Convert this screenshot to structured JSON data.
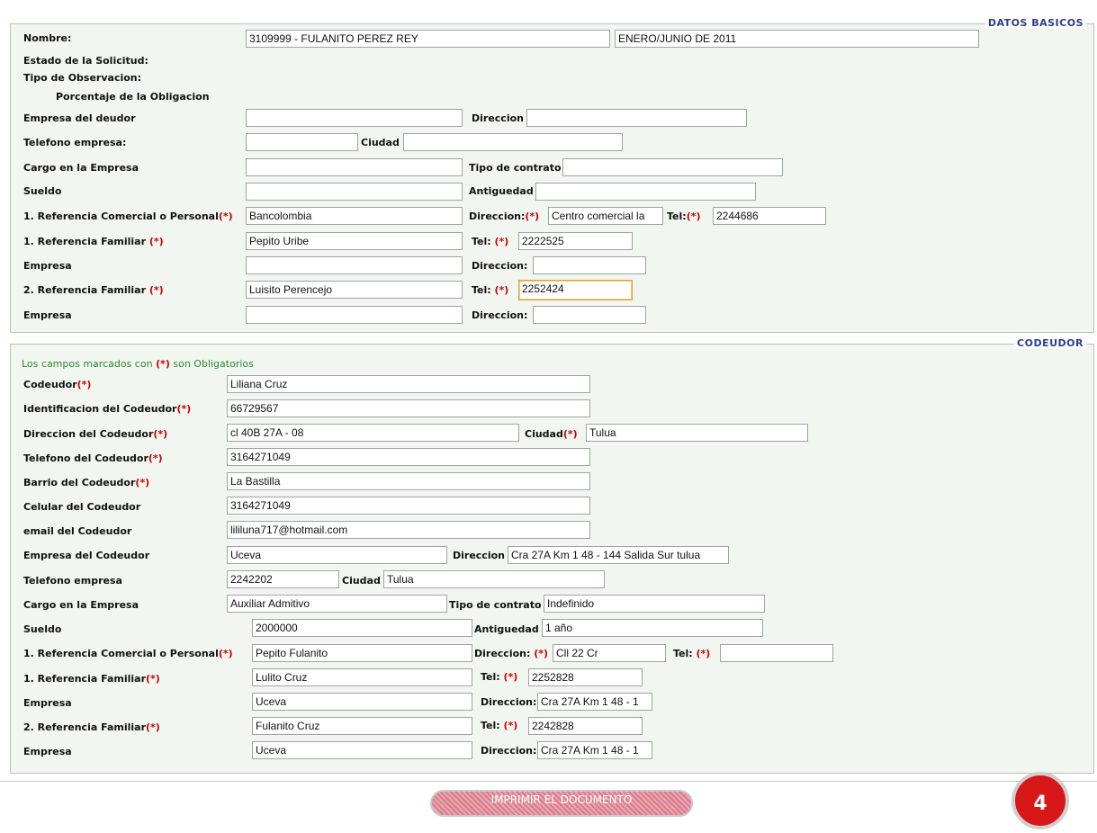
{
  "basic": {
    "legend": "DATOS BASICOS",
    "nombre_label": "Nombre:",
    "nombre_value": "3109999 - FULANITO PEREZ REY",
    "periodo_value": "ENERO/JUNIO DE 2011",
    "estado_label": "Estado de la Solicitud:",
    "tipo_obs_label": "Tipo de Observacion:",
    "porcentaje_label": "Porcentaje de la Obligacion",
    "empresa_deudor_label": "Empresa del deudor",
    "empresa_deudor_value": "",
    "direccion_label": "Direccion",
    "direccion_value": "",
    "telefono_empresa_label": "Telefono empresa:",
    "telefono_empresa_value": "",
    "ciudad_label": "Ciudad",
    "ciudad_value": "",
    "cargo_label": "Cargo en la Empresa",
    "cargo_value": "",
    "tipo_contrato_label": "Tipo de contrato",
    "tipo_contrato_value": "",
    "sueldo_label": "Sueldo",
    "sueldo_value": "",
    "antiguedad_label": "Antiguedad",
    "antiguedad_value": "",
    "ref_comercial_label": "1. Referencia Comercial o Personal",
    "ref_comercial_value": "Bancolombia",
    "ref_comercial_dir_label": "Direccion:",
    "ref_comercial_dir_value": "Centro comercial la",
    "ref_comercial_tel_label": "Tel:",
    "ref_comercial_tel_value": "2244686",
    "ref_fam1_label": "1. Referencia Familiar",
    "ref_fam1_value": "Pepito Uribe",
    "ref_fam1_tel_label": "Tel:",
    "ref_fam1_tel_value": "2222525",
    "empresa1_label": "Empresa",
    "empresa1_value": "",
    "empresa1_dir_label": "Direccion:",
    "empresa1_dir_value": "",
    "ref_fam2_label": "2. Referencia Familiar",
    "ref_fam2_value": "Luisito Perencejo",
    "ref_fam2_tel_label": "Tel:",
    "ref_fam2_tel_value": "2252424",
    "empresa2_label": "Empresa",
    "empresa2_value": "",
    "empresa2_dir_label": "Direccion:",
    "empresa2_dir_value": ""
  },
  "cod": {
    "legend": "CODEUDOR",
    "note_pre": "Los campos marcados con ",
    "note_post": " son Obligatorios",
    "req_mark": "(*)",
    "codeudor_label": "Codeudor",
    "codeudor_value": "Liliana Cruz",
    "identificacion_label": "Identificacion del Codeudor",
    "identificacion_value": "66729567",
    "direccion_label": "Direccion del Codeudor",
    "direccion_value": "cl 40B 27A - 08",
    "ciudad_label": "Ciudad",
    "ciudad_value": "Tulua",
    "telefono_label": "Telefono del Codeudor",
    "telefono_value": "3164271049",
    "barrio_label": "Barrio del Codeudor",
    "barrio_value": "La Bastilla",
    "celular_label": "Celular del Codeudor",
    "celular_value": "3164271049",
    "email_label": "email del Codeudor",
    "email_value": "lililuna717@hotmail.com",
    "empresa_label": "Empresa del Codeudor",
    "empresa_value": "Uceva",
    "empresa_dir_label": "Direccion",
    "empresa_dir_value": "Cra 27A Km 1 48 - 144 Salida Sur tulua",
    "tel_empresa_label": "Telefono empresa",
    "tel_empresa_value": "2242202",
    "ciudad2_label": "Ciudad",
    "ciudad2_value": "Tulua",
    "cargo_label": "Cargo en la Empresa",
    "cargo_value": "Auxiliar Admitivo",
    "tipo_contrato_label": "Tipo de contrato",
    "tipo_contrato_value": "Indefinido",
    "sueldo_label": "Sueldo",
    "sueldo_value": "2000000",
    "antiguedad_label": "Antiguedad",
    "antiguedad_value": "1 año",
    "ref_comercial_label": "1. Referencia Comercial o Personal",
    "ref_comercial_value": "Pepito Fulanito",
    "ref_comercial_dir_label": "Direccion:",
    "ref_comercial_dir_value": "Cll 22 Cr",
    "ref_comercial_tel_label": "Tel:",
    "ref_comercial_tel_value": "",
    "ref_fam1_label": "1. Referencia Familiar",
    "ref_fam1_value": "Lulito Cruz",
    "ref_fam1_tel_label": "Tel:",
    "ref_fam1_tel_value": "2252828",
    "empresa1_label": "Empresa",
    "empresa1_value": "Uceva",
    "empresa1_dir_label": "Direccion:",
    "empresa1_dir_value": "Cra 27A Km 1 48 - 1",
    "ref_fam2_label": "2. Referencia Familiar",
    "ref_fam2_value": "Fulanito Cruz",
    "ref_fam2_tel_label": "Tel:",
    "ref_fam2_tel_value": "2242828",
    "empresa2_label": "Empresa",
    "empresa2_value": "Uceva",
    "empresa2_dir_label": "Direccion:",
    "empresa2_dir_value": "Cra 27A Km 1 48 - 1"
  },
  "footer": {
    "print_label": "IMPRIMIR EL DOCUMENTO",
    "step_number": "4"
  }
}
